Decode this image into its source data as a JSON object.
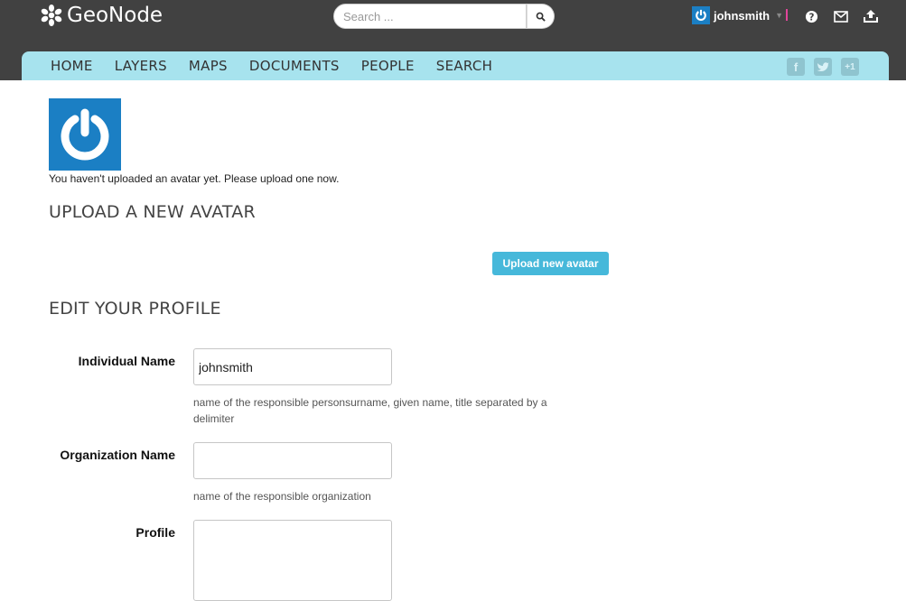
{
  "header": {
    "brand": "GeoNode",
    "search_placeholder": "Search ...",
    "username": "johnsmith"
  },
  "nav": {
    "items": [
      "HOME",
      "LAYERS",
      "MAPS",
      "DOCUMENTS",
      "PEOPLE",
      "SEARCH"
    ]
  },
  "social": {
    "facebook": "f",
    "googleplus": "+1"
  },
  "avatar": {
    "message": "You haven't uploaded an avatar yet. Please upload one now."
  },
  "upload_section": {
    "title": "UPLOAD A NEW AVATAR",
    "button_label": "Upload new avatar"
  },
  "profile_section": {
    "title": "EDIT YOUR PROFILE",
    "fields": [
      {
        "label": "Individual Name",
        "value": "johnsmith",
        "help": "name of the responsible personsurname, given name, title separated by a delimiter"
      },
      {
        "label": "Organization Name",
        "value": "",
        "help": "name of the responsible organization"
      },
      {
        "label": "Profile",
        "value": ""
      }
    ]
  },
  "colors": {
    "topbar": "#414141",
    "navbar": "#a7e3ee",
    "accent": "#46b8da",
    "avatar": "#1b7fc4"
  }
}
